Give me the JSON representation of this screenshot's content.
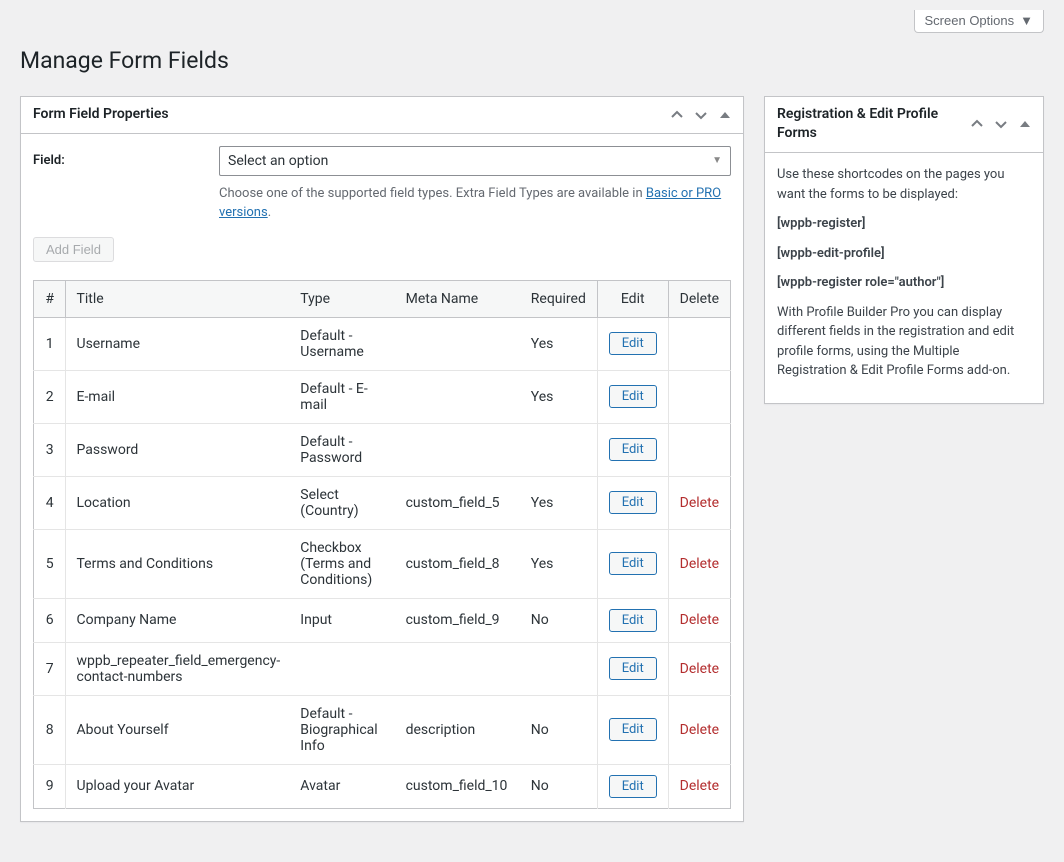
{
  "topbar": {
    "screen_options": "Screen Options"
  },
  "page_title": "Manage Form Fields",
  "main_panel": {
    "title": "Form Field Properties",
    "field_label": "Field:",
    "select_placeholder": "Select an option",
    "help_text_1": "Choose one of the supported field types. Extra Field Types are available in ",
    "help_link": "Basic or PRO versions",
    "help_text_2": ".",
    "add_field": "Add Field"
  },
  "table": {
    "headers": {
      "num": "#",
      "title": "Title",
      "type": "Type",
      "meta": "Meta Name",
      "required": "Required",
      "edit": "Edit",
      "delete": "Delete"
    },
    "edit_label": "Edit",
    "delete_label": "Delete",
    "rows": [
      {
        "num": "1",
        "title": "Username",
        "type": "Default - Username",
        "meta": "",
        "required": "Yes",
        "deletable": false
      },
      {
        "num": "2",
        "title": "E-mail",
        "type": "Default - E-mail",
        "meta": "",
        "required": "Yes",
        "deletable": false
      },
      {
        "num": "3",
        "title": "Password",
        "type": "Default - Password",
        "meta": "",
        "required": "",
        "deletable": false
      },
      {
        "num": "4",
        "title": "Location",
        "type": "Select (Country)",
        "meta": "custom_field_5",
        "required": "Yes",
        "deletable": true
      },
      {
        "num": "5",
        "title": "Terms and Conditions",
        "type": "Checkbox (Terms and Conditions)",
        "meta": "custom_field_8",
        "required": "Yes",
        "deletable": true
      },
      {
        "num": "6",
        "title": "Company Name",
        "type": "Input",
        "meta": "custom_field_9",
        "required": "No",
        "deletable": true
      },
      {
        "num": "7",
        "title": "wppb_repeater_field_emergency-contact-numbers",
        "type": "",
        "meta": "",
        "required": "",
        "deletable": true
      },
      {
        "num": "8",
        "title": "About Yourself",
        "type": "Default - Biographical Info",
        "meta": "description",
        "required": "No",
        "deletable": true
      },
      {
        "num": "9",
        "title": "Upload your Avatar",
        "type": "Avatar",
        "meta": "custom_field_10",
        "required": "No",
        "deletable": true
      }
    ]
  },
  "side_panel": {
    "title": "Registration & Edit Profile Forms",
    "intro": "Use these shortcodes on the pages you want the forms to be displayed:",
    "shortcodes": [
      "[wppb-register]",
      "[wppb-edit-profile]",
      "[wppb-register role=\"author\"]"
    ],
    "outro": "With Profile Builder Pro you can display different fields in the registration and edit profile forms, using the Multiple Registration & Edit Profile Forms add-on."
  }
}
